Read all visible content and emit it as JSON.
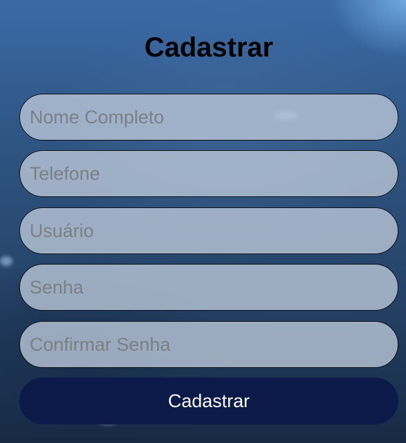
{
  "form": {
    "title": "Cadastrar",
    "fields": [
      {
        "placeholder": "Nome Completo",
        "value": ""
      },
      {
        "placeholder": "Telefone",
        "value": ""
      },
      {
        "placeholder": "Usuário",
        "value": ""
      },
      {
        "placeholder": "Senha",
        "value": ""
      },
      {
        "placeholder": "Confirmar Senha",
        "value": ""
      }
    ],
    "submit_label": "Cadastrar"
  },
  "colors": {
    "button_background": "#0b1a48",
    "button_text": "#ffffff",
    "field_background": "#b7c4d6",
    "field_border": "#0c0f16",
    "title_text": "#000000",
    "background_top": "#3a6aa6",
    "background_bottom": "#172a44"
  }
}
